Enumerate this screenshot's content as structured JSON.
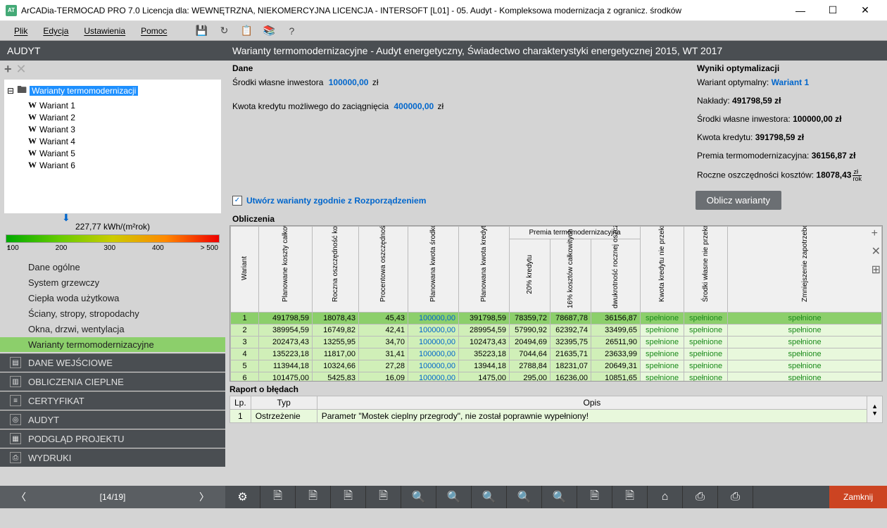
{
  "window": {
    "title": "ArCADia-TERMOCAD PRO 7.0 Licencja dla: WEWNĘTRZNA, NIEKOMERCYJNA LICENCJA - INTERSOFT [L01] - 05. Audyt - Kompleksowa modernizacja z ogranicz. środków",
    "app_icon_text": "AT"
  },
  "menu": {
    "items": [
      "Plik",
      "Edycja",
      "Ustawienia",
      "Pomoc"
    ],
    "tool_icons": [
      "save-icon",
      "refresh-icon",
      "clipboard-icon",
      "book-icon",
      "help-icon"
    ]
  },
  "sidebar": {
    "title": "AUDYT",
    "add_icon": "+",
    "close_icon": "✕",
    "tree": {
      "root": "Warianty termomodernizacji",
      "items": [
        "Wariant 1",
        "Wariant 2",
        "Wariant 3",
        "Wariant 4",
        "Wariant 5",
        "Wariant 6"
      ]
    },
    "gauge": {
      "value_label": "227,77 kWh/(m²rok)",
      "ticks": [
        "100",
        "200",
        "300",
        "400",
        "> 500"
      ]
    },
    "nav": [
      {
        "label": "Dane ogólne",
        "active": false
      },
      {
        "label": "System grzewczy",
        "active": false
      },
      {
        "label": "Ciepła woda użytkowa",
        "active": false
      },
      {
        "label": "Ściany, stropy, stropodachy",
        "active": false
      },
      {
        "label": "Okna, drzwi, wentylacja",
        "active": false
      },
      {
        "label": "Warianty termomodernizacyjne",
        "active": true
      }
    ],
    "sections": [
      "DANE WEJŚCIOWE",
      "OBLICZENIA CIEPLNE",
      "CERTYFIKAT",
      "AUDYT",
      "PODGLĄD PROJEKTU",
      "WYDRUKI"
    ]
  },
  "main": {
    "header": "Warianty termomodernizacyjne - Audyt energetyczny, Świadectwo charakterystyki energetycznej 2015, WT 2017",
    "dane": {
      "title": "Dane",
      "row1_label": "Środki własne inwestora",
      "row1_value": "100000,00",
      "row1_unit": "zł",
      "row2_label": "Kwota kredytu możliwego do zaciągnięcia",
      "row2_value": "400000,00",
      "row2_unit": "zł"
    },
    "wyniki": {
      "title": "Wyniki optymalizacji",
      "optimal_label": "Wariant optymalny:",
      "optimal_value": "Wariant 1",
      "naklady_label": "Nakłady:",
      "naklady_value": "491798,59 zł",
      "srodki_label": "Środki własne inwestora:",
      "srodki_value": "100000,00 zł",
      "kredyt_label": "Kwota kredytu:",
      "kredyt_value": "391798,59 zł",
      "premia_label": "Premia termomodernizacyjna:",
      "premia_value": "36156,87 zł",
      "roczne_label": "Roczne oszczędności kosztów:",
      "roczne_value": "18078,43",
      "roczne_unit_top": "zł",
      "roczne_unit_bot": "rok"
    },
    "checkbox_label": "Utwórz warianty zgodnie z Rozporządzeniem",
    "button_calc": "Oblicz warianty",
    "calc_title": "Obliczenia",
    "calc_headers": {
      "wariant": "Wariant",
      "plan_koszty": "Planowane koszty całkowite",
      "roczna": "Roczna oszczędność kosztów energii",
      "procent": "Procentowa oszczędność zapotrzebowania na energię",
      "plan_srodki": "Planowana kwota środków własnych",
      "plan_kredyt": "Planowana kwota kredytu",
      "premia_super": "Premia termomodernizacyjna",
      "p20": "20% kredytu",
      "p16": "16% kosztów całkowitych",
      "dwu": "dwukrotność rocznej oszczędności kosztów energii",
      "kwota_nie": "Kwota kredytu nie przekracza wartości przedsięwzięcia",
      "srodki_nie": "Środki własne nie przekraczają wartości zadeklarowanej",
      "zmniejszenie": "Zmniejszenie zapotrzebowania na energię w ciągu roku"
    },
    "calc_rows": [
      {
        "n": "1",
        "a": "491798,59",
        "b": "18078,43",
        "c": "45,43",
        "d": "100000,00",
        "e": "391798,59",
        "f": "78359,72",
        "g": "78687,78",
        "h": "36156,87",
        "i": "spełnione",
        "j": "spełnione",
        "k": "spełnione"
      },
      {
        "n": "2",
        "a": "389954,59",
        "b": "16749,82",
        "c": "42,41",
        "d": "100000,00",
        "e": "289954,59",
        "f": "57990,92",
        "g": "62392,74",
        "h": "33499,65",
        "i": "spełnione",
        "j": "spełnione",
        "k": "spełnione"
      },
      {
        "n": "3",
        "a": "202473,43",
        "b": "13255,95",
        "c": "34,70",
        "d": "100000,00",
        "e": "102473,43",
        "f": "20494,69",
        "g": "32395,75",
        "h": "26511,90",
        "i": "spełnione",
        "j": "spełnione",
        "k": "spełnione"
      },
      {
        "n": "4",
        "a": "135223,18",
        "b": "11817,00",
        "c": "31,41",
        "d": "100000,00",
        "e": "35223,18",
        "f": "7044,64",
        "g": "21635,71",
        "h": "23633,99",
        "i": "spełnione",
        "j": "spełnione",
        "k": "spełnione"
      },
      {
        "n": "5",
        "a": "113944,18",
        "b": "10324,66",
        "c": "27,28",
        "d": "100000,00",
        "e": "13944,18",
        "f": "2788,84",
        "g": "18231,07",
        "h": "20649,31",
        "i": "spełnione",
        "j": "spełnione",
        "k": "spełnione"
      },
      {
        "n": "6",
        "a": "101475,00",
        "b": "5425,83",
        "c": "16,09",
        "d": "100000,00",
        "e": "1475,00",
        "f": "295,00",
        "g": "16236,00",
        "h": "10851,65",
        "i": "spełnione",
        "j": "spełnione",
        "k": "spełnione"
      }
    ],
    "errors": {
      "title": "Raport o błędach",
      "col_lp": "Lp.",
      "col_typ": "Typ",
      "col_opis": "Opis",
      "row1_lp": "1",
      "row1_typ": "Ostrzeżenie",
      "row1_opis": "Parametr \"Mostek cieplny przegrody\", nie został poprawnie wypełniony!"
    }
  },
  "footer": {
    "page": "[14/19]",
    "close": "Zamknij"
  }
}
